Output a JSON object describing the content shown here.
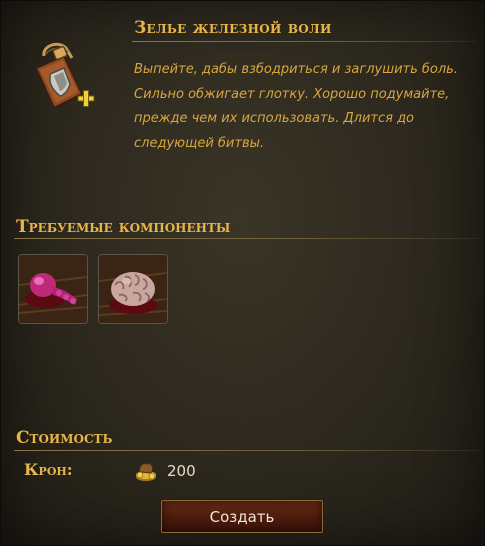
{
  "item": {
    "title": "Зелье железной воли",
    "icon": "iron-will-potion-icon",
    "description": "Выпейте, дабы взбодриться и заглушить боль. Сильно обжигает глотку. Хорошо подумайте, прежде чем их использовать. Длится до следующей битвы."
  },
  "components": {
    "title": "Требуемые компоненты",
    "items": [
      {
        "icon": "pink-organ-ingredient-icon"
      },
      {
        "icon": "brain-ingredient-icon"
      }
    ]
  },
  "cost": {
    "title": "Стоимость",
    "currency_label": "Крон:",
    "currency_icon": "crown-coins-icon",
    "amount": "200"
  },
  "actions": {
    "create_label": "Создать"
  },
  "colors": {
    "accent_gold": "#e8b548",
    "description_gold": "#d9a63f",
    "button_red": "#5a2010"
  }
}
